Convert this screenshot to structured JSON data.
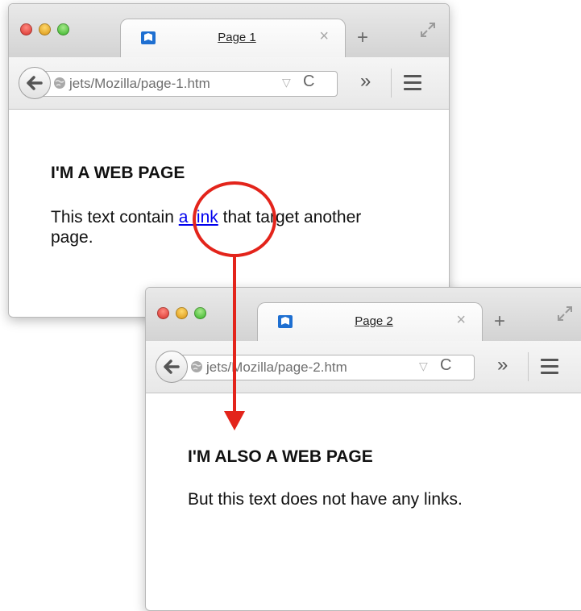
{
  "page1": {
    "tab_title": "Page 1",
    "url": "jets/Mozilla/page-1.htm",
    "heading": "I'M A WEB PAGE",
    "text_before": "This text contain ",
    "link_text": "a link",
    "text_after": " that target another page."
  },
  "page2": {
    "tab_title": "Page 2",
    "url": "jets/Mozilla/page-2.htm",
    "heading": "I'M ALSO A WEB PAGE",
    "text": "But this text does not have any links."
  },
  "icons": {
    "close_tab": "×",
    "new_tab": "+",
    "overflow": "»",
    "dropdown": "▽",
    "reload": "C"
  },
  "colors": {
    "annotation": "#e3241b",
    "link": "#0000ee"
  }
}
